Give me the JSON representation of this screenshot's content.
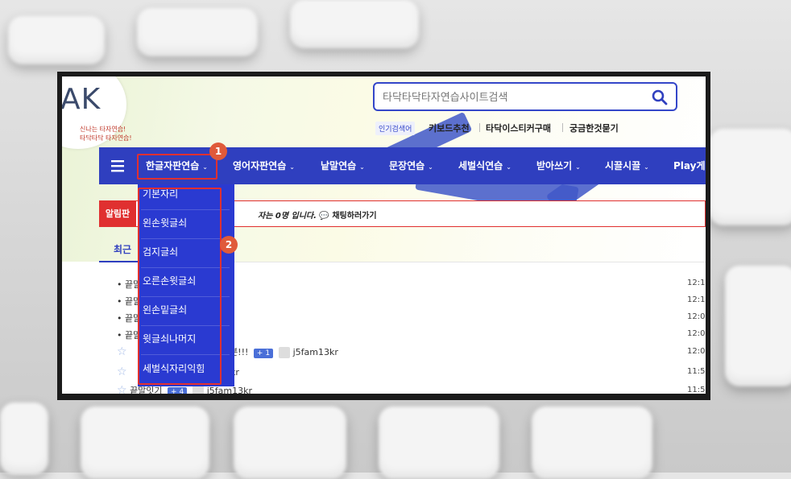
{
  "logo": {
    "text": "AK",
    "tagline_1": "신나는 타자연습!",
    "tagline_2": "타닥타닥 타자연습!"
  },
  "search": {
    "placeholder": "타닥타닥타자연습사이트검색"
  },
  "popular": {
    "label": "인기검색어",
    "links": [
      "키보드추천",
      "타닥이스티커구매",
      "궁금한것묻기"
    ]
  },
  "nav": {
    "items": [
      {
        "label": "한글자판연습"
      },
      {
        "label": "영어자판연습"
      },
      {
        "label": "낱말연습"
      },
      {
        "label": "문장연습"
      },
      {
        "label": "세벌식연습"
      },
      {
        "label": "받아쓰기"
      },
      {
        "label": "시끌시끌"
      },
      {
        "label": "Play게임"
      }
    ]
  },
  "dropdown": {
    "items": [
      "기본자리",
      "왼손윗글쇠",
      "검지글쇠",
      "오른손윗글쇠",
      "왼손밑글쇠",
      "윗글쇠나머지",
      "세벌식자리익힘"
    ]
  },
  "alert": {
    "badge": "알림판",
    "text": "자는 0명 입니다.",
    "chat_link": "채팅하러가기"
  },
  "recent": {
    "title": "최근",
    "rows": [
      {
        "prefix": "끝말",
        "time": "12:1"
      },
      {
        "prefix": "끝말",
        "time": "12:1"
      },
      {
        "prefix": "끝말",
        "time": "12:0"
      },
      {
        "prefix": "끝말",
        "time": "12:0"
      },
      {
        "prefix": "분!!!",
        "count": "+ 1",
        "user": "j5fam13kr",
        "time": "12:0"
      },
      {
        "user": "3kr",
        "time": "11:5"
      },
      {
        "prefix": "끝말잇기",
        "count": "+ 4",
        "user": "j5fam13kr",
        "time": "11:5"
      }
    ]
  },
  "markers": [
    "1",
    "2"
  ],
  "colors": {
    "nav": "#2f3fbf",
    "dropdown": "#2a3ad1",
    "highlight": "#e03030",
    "marker": "#e05a3a"
  }
}
